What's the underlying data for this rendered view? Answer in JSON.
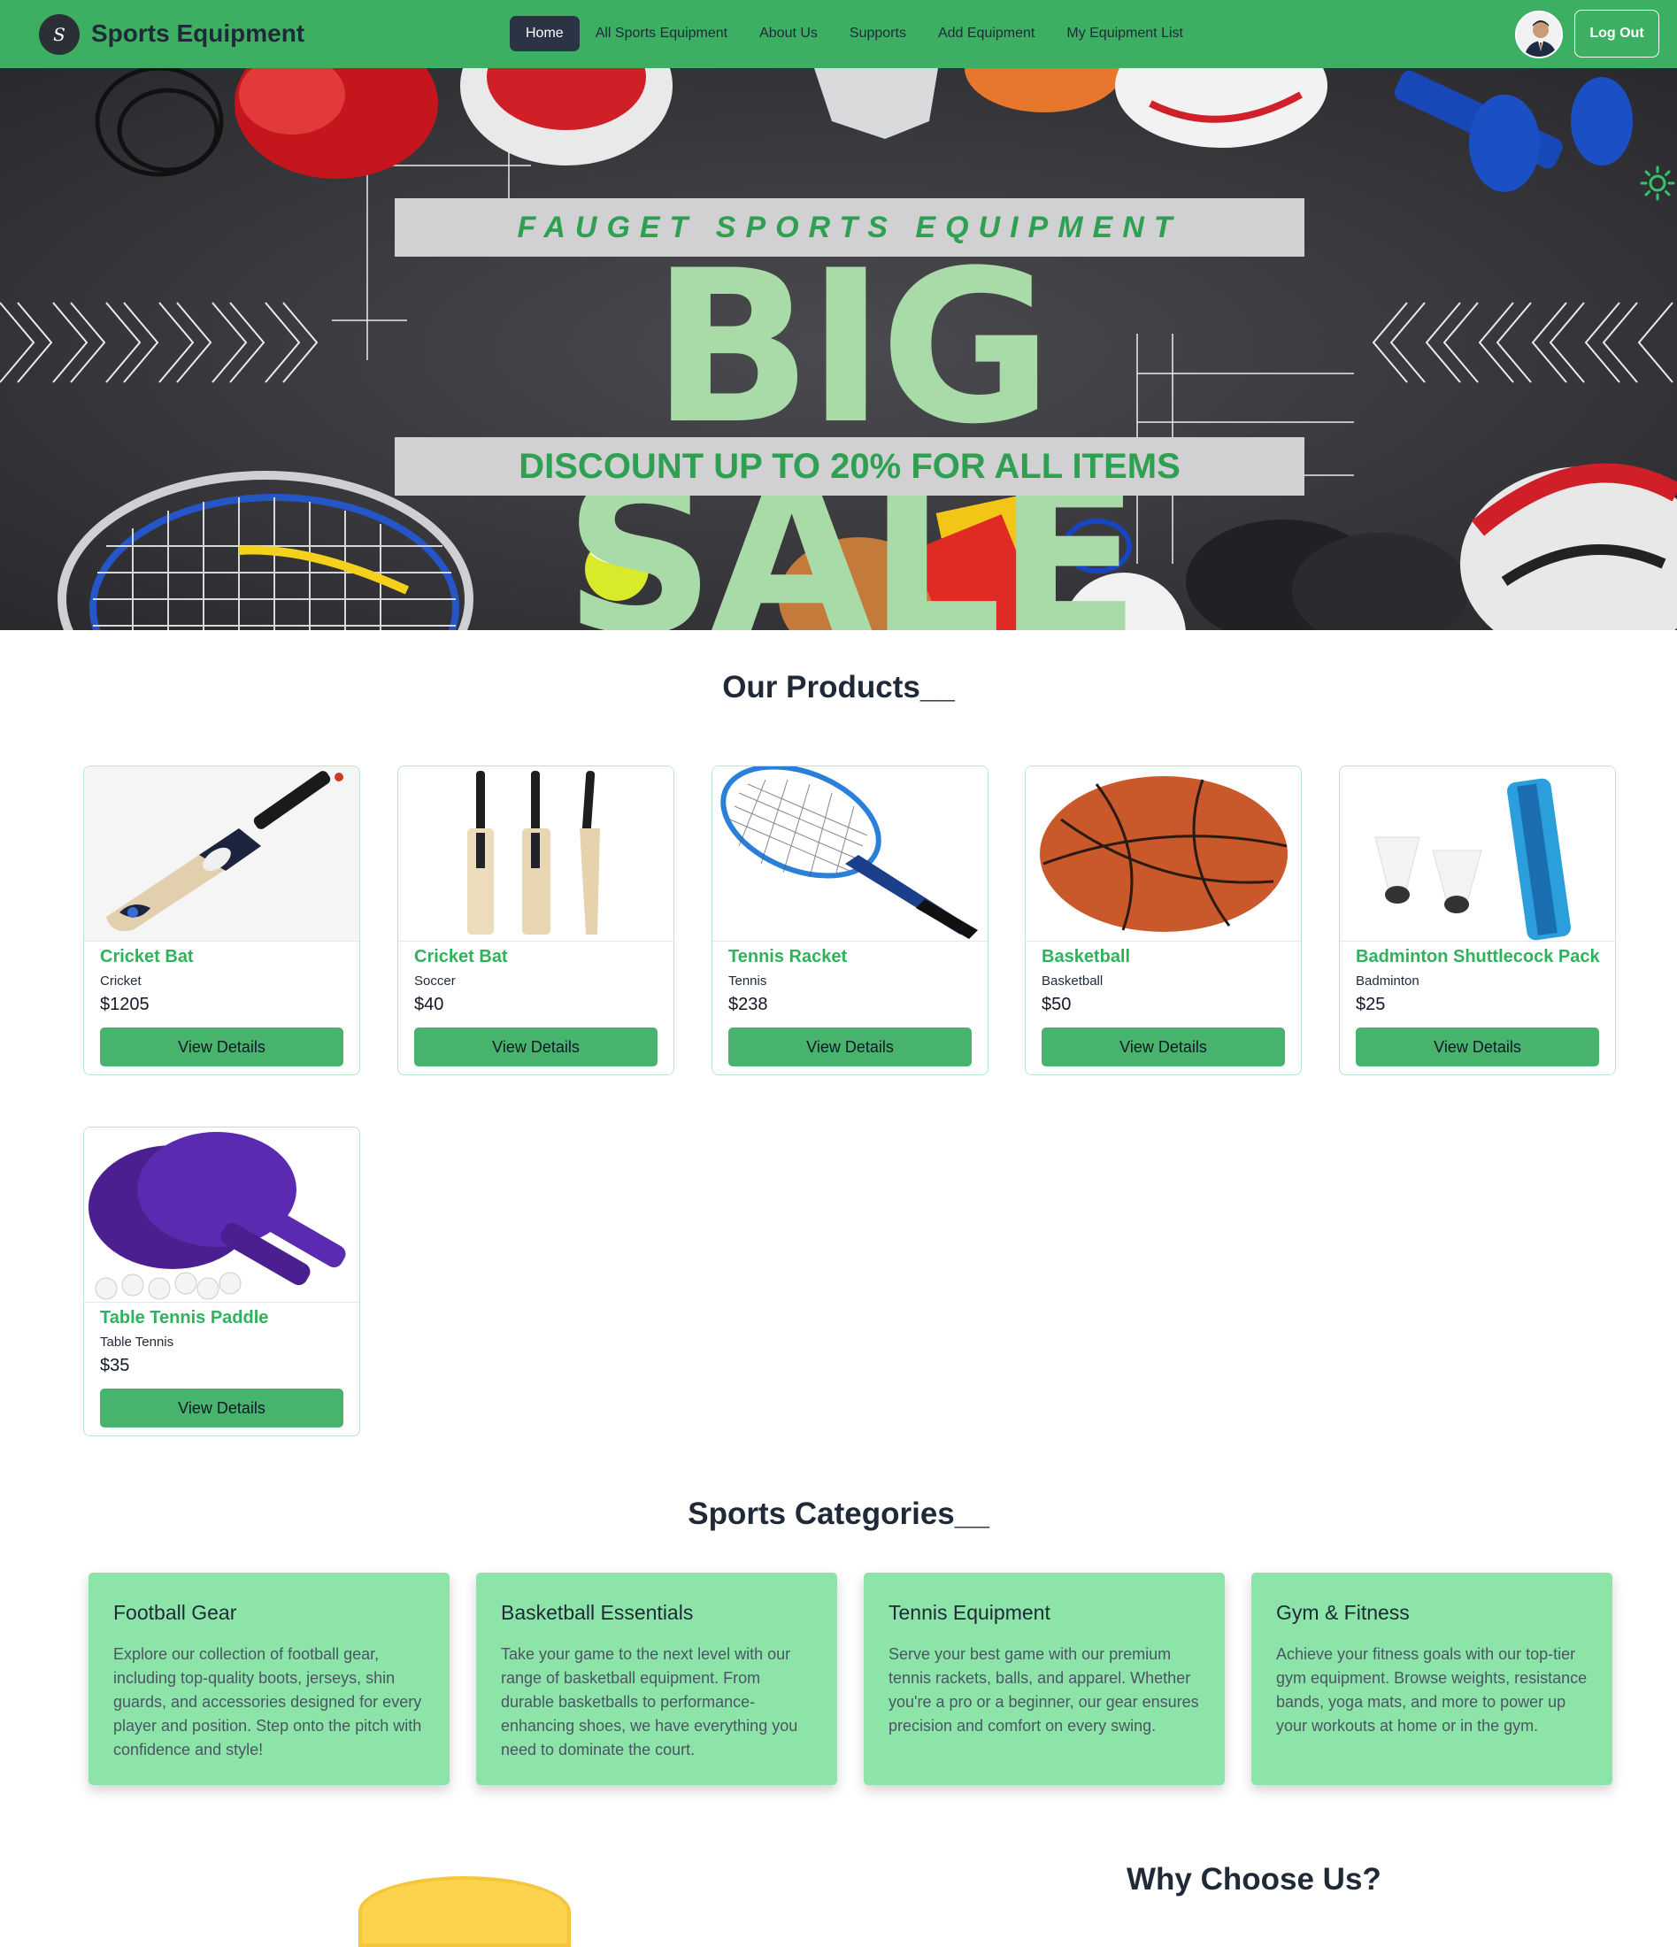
{
  "nav": {
    "logo_text": "S",
    "brand": "Sports Equipment",
    "menu": [
      {
        "label": "Home",
        "active": true
      },
      {
        "label": "All Sports Equipment",
        "active": false
      },
      {
        "label": "About Us",
        "active": false
      },
      {
        "label": "Supports",
        "active": false
      },
      {
        "label": "Add Equipment",
        "active": false
      },
      {
        "label": "My Equipment List",
        "active": false
      }
    ],
    "logout": "Log Out"
  },
  "hero": {
    "kicker": "FAUGET SPORTS EQUIPMENT",
    "title": "BIG SALE",
    "subtitle": "DISCOUNT UP TO 20% FOR ALL ITEMS",
    "theme_toggle_icon": "sun-icon"
  },
  "products_section": {
    "title": "Our Products__",
    "products": [
      {
        "name": "Cricket Bat",
        "category": "Cricket",
        "price": "$1205",
        "button": "View Details"
      },
      {
        "name": "Cricket Bat",
        "category": "Soccer",
        "price": "$40",
        "button": "View Details"
      },
      {
        "name": "Tennis Racket",
        "category": "Tennis",
        "price": "$238",
        "button": "View Details"
      },
      {
        "name": "Basketball",
        "category": "Basketball",
        "price": "$50",
        "button": "View Details"
      },
      {
        "name": "Badminton Shuttlecock Pack",
        "category": "Badminton",
        "price": "$25",
        "button": "View Details"
      },
      {
        "name": "Table Tennis Paddle",
        "category": "Table Tennis",
        "price": "$35",
        "button": "View Details"
      }
    ]
  },
  "categories_section": {
    "title": "Sports Categories__",
    "categories": [
      {
        "title": "Football Gear",
        "text": "Explore our collection of football gear, including top-quality boots, jerseys, shin guards, and accessories designed for every player and position. Step onto the pitch with confidence and style!"
      },
      {
        "title": "Basketball Essentials",
        "text": "Take your game to the next level with our range of basketball equipment. From durable basketballs to performance-enhancing shoes, we have everything you need to dominate the court."
      },
      {
        "title": "Tennis Equipment",
        "text": "Serve your best game with our premium tennis rackets, balls, and apparel. Whether you're a pro or a beginner, our gear ensures precision and comfort on every swing."
      },
      {
        "title": "Gym & Fitness",
        "text": "Achieve your fitness goals with our top-tier gym equipment. Browse weights, resistance bands, yoga mats, and more to power up your workouts at home or in the gym."
      }
    ]
  },
  "why_section": {
    "title": "Why Choose Us?"
  },
  "colors": {
    "nav_bg": "#3daf63",
    "accent_green": "#2fb25c",
    "button_green": "#48b36c",
    "category_bg": "#8de4a9",
    "hero_title": "#a8dba7"
  }
}
